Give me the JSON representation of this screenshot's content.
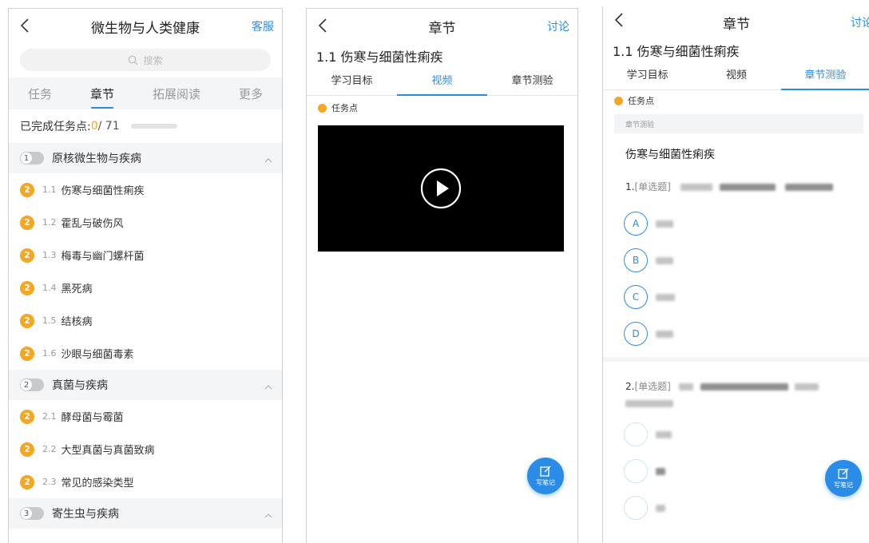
{
  "panel1": {
    "title": "微生物与人类健康",
    "right": "客服",
    "search_placeholder": "搜索",
    "tabs": [
      "任务",
      "章节",
      "拓展阅读",
      "更多"
    ],
    "progress_label": "已完成任务点: ",
    "progress_done": "0",
    "progress_total": "/ 71",
    "progress_fraction": 0,
    "chapters": [
      {
        "num": "1",
        "title": "原核微生物与疾病",
        "sections": [
          {
            "badge": "2",
            "num": "1.1",
            "title": "伤寒与细菌性痢疾"
          },
          {
            "badge": "2",
            "num": "1.2",
            "title": "霍乱与破伤风"
          },
          {
            "badge": "2",
            "num": "1.3",
            "title": "梅毒与幽门螺杆菌"
          },
          {
            "badge": "2",
            "num": "1.4",
            "title": "黑死病"
          },
          {
            "badge": "2",
            "num": "1.5",
            "title": "结核病"
          },
          {
            "badge": "2",
            "num": "1.6",
            "title": "沙眼与细菌毒素"
          }
        ]
      },
      {
        "num": "2",
        "title": "真菌与疾病",
        "sections": [
          {
            "badge": "2",
            "num": "2.1",
            "title": "酵母菌与霉菌"
          },
          {
            "badge": "2",
            "num": "2.2",
            "title": "大型真菌与真菌致病"
          },
          {
            "badge": "2",
            "num": "2.3",
            "title": "常见的感染类型"
          }
        ]
      },
      {
        "num": "3",
        "title": "寄生虫与疾病",
        "sections": []
      }
    ]
  },
  "panel2": {
    "title": "章节",
    "right": "讨论",
    "chapter_title": "1.1 伤寒与细菌性痢疾",
    "tabs": [
      "学习目标",
      "视频",
      "章节测验"
    ],
    "task_point": "任务点",
    "fab_label": "写笔记"
  },
  "panel3": {
    "title": "章节",
    "right": "讨论",
    "chapter_title": "1.1 伤寒与细菌性痢疾",
    "tabs": [
      "学习目标",
      "视频",
      "章节测验"
    ],
    "task_point": "任务点",
    "quiz_header": "章节测验",
    "quiz_title": "伤寒与细菌性痢疾",
    "q1_prefix": "1.",
    "q1_type": "[单选题]",
    "q2_prefix": "2.",
    "q2_type": "[单选题]",
    "options": [
      "A",
      "B",
      "C",
      "D"
    ],
    "fab_label": "写笔记"
  },
  "colors": {
    "accent": "#2b8ce8",
    "badge": "#f5a623"
  }
}
